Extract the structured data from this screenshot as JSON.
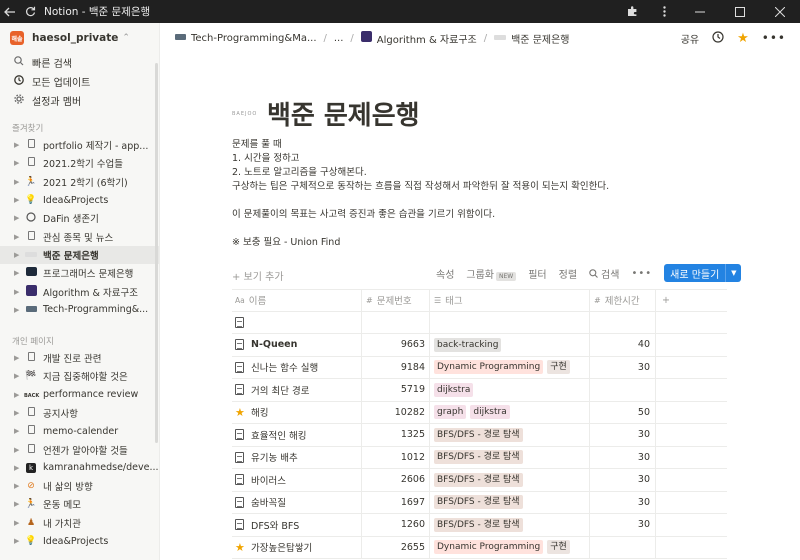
{
  "window": {
    "title": "Notion - 백준 문제은행"
  },
  "workspace": {
    "name": "haesol_private",
    "logo_text": "해솔"
  },
  "sidebar": {
    "top_items": [
      {
        "icon": "search-icon",
        "label": "빠른 검색"
      },
      {
        "icon": "clock-icon",
        "label": "모든 업데이트"
      },
      {
        "icon": "gear-icon",
        "label": "설정과 멤버"
      }
    ],
    "favorites_label": "즐겨찾기",
    "favorites": [
      {
        "icon": "doc-icon",
        "label": "portfolio 제작기 - app..."
      },
      {
        "icon": "doc-icon",
        "label": "2021.2학기 수업들"
      },
      {
        "icon": "runner-icon",
        "label": "2021 2학기 (6학기)"
      },
      {
        "icon": "bulb-icon",
        "label": "Idea&Projects"
      },
      {
        "icon": "circle-icon",
        "label": "DaFin 생존기"
      },
      {
        "icon": "doc-icon",
        "label": "관심 종목 및 뉴스"
      },
      {
        "icon": "baekjoon-icon",
        "label": "백준 문제은행",
        "active": true
      },
      {
        "icon": "programmers-icon",
        "label": "프로그래머스 문제은행"
      },
      {
        "icon": "algorithm-icon",
        "label": "Algorithm & 자료구조"
      },
      {
        "icon": "laptop-icon",
        "label": "Tech-Programming&..."
      }
    ],
    "private_label": "개인 페이지",
    "private": [
      {
        "icon": "doc-icon",
        "label": "개발 진로 관련"
      },
      {
        "icon": "flag-icon",
        "label": "지금 집중해야할 것은"
      },
      {
        "icon": "back-icon",
        "label": "performance review"
      },
      {
        "icon": "doc-icon",
        "label": "공지사항"
      },
      {
        "icon": "doc-icon",
        "label": "memo-calender"
      },
      {
        "icon": "doc-icon",
        "label": "언젠가 알아야할 것들"
      },
      {
        "icon": "k-icon",
        "label": "kamranahmedse/deve..."
      },
      {
        "icon": "no-icon",
        "label": "내 삶의 방향"
      },
      {
        "icon": "runner-icon",
        "label": "운동 메모"
      },
      {
        "icon": "pawn-icon",
        "label": "내 가치관"
      },
      {
        "icon": "bulb-icon",
        "label": "Idea&Projects"
      }
    ]
  },
  "topbar": {
    "breadcrumbs": [
      {
        "icon": "laptop-icon",
        "label": "Tech-Programming&Ma..."
      },
      {
        "icon": "",
        "label": "..."
      },
      {
        "icon": "algorithm-icon",
        "label": "Algorithm & 자료구조"
      },
      {
        "icon": "baekjoon-icon",
        "label": "백준 문제은행"
      }
    ],
    "share_label": "공유"
  },
  "page": {
    "icon_text": "BAEJOO",
    "title": "백준 문제은행",
    "description": [
      "문제를 풀 때",
      "1. 시간을 정하고",
      "2. 노트로 알고리즘을 구상해본다.",
      "구상하는 팁은 구체적으로 동작하는 흐름을 직접 작성해서 파악한뒤 잘 적용이 되는지 확인한다.",
      "",
      "이 문제풀이의 목표는 사고력 증진과 좋은 습관을 기르기 위함이다.",
      "",
      "※ 보충 필요 - Union Find"
    ]
  },
  "database": {
    "add_view_label": "+ 보기 추가",
    "tools": [
      "속성",
      "그룹화",
      "필터",
      "정렬",
      "검색"
    ],
    "new_badge": "NEW",
    "new_button_label": "새로 만들기",
    "columns": [
      "이름",
      "문제번호",
      "태그",
      "제한시간"
    ],
    "rows": [
      {
        "icon": "doc",
        "name": "",
        "number": "",
        "tags": [],
        "time": ""
      },
      {
        "icon": "doc",
        "name": "N-Queen",
        "bold": true,
        "number": "9663",
        "tags": [
          {
            "t": "back-tracking",
            "c": "gray"
          }
        ],
        "time": "40"
      },
      {
        "icon": "doc",
        "name": "신나는 함수 실행",
        "number": "9184",
        "tags": [
          {
            "t": "Dynamic Programming",
            "c": "red"
          },
          {
            "t": "구현",
            "c": "tan"
          }
        ],
        "time": "30"
      },
      {
        "icon": "doc",
        "name": "거의 최단 경로",
        "number": "5719",
        "tags": [
          {
            "t": "dijkstra",
            "c": "pink"
          }
        ],
        "time": ""
      },
      {
        "icon": "star",
        "name": "해킹",
        "number": "10282",
        "tags": [
          {
            "t": "graph",
            "c": "pink"
          },
          {
            "t": "dijkstra",
            "c": "pink"
          }
        ],
        "time": "50"
      },
      {
        "icon": "doc",
        "name": "효율적인 해킹",
        "number": "1325",
        "tags": [
          {
            "t": "BFS/DFS - 경로 탐색",
            "c": "brown"
          }
        ],
        "time": "30"
      },
      {
        "icon": "doc",
        "name": "유기농 배추",
        "number": "1012",
        "tags": [
          {
            "t": "BFS/DFS - 경로 탐색",
            "c": "brown"
          }
        ],
        "time": "30"
      },
      {
        "icon": "doc",
        "name": "바이러스",
        "number": "2606",
        "tags": [
          {
            "t": "BFS/DFS - 경로 탐색",
            "c": "brown"
          }
        ],
        "time": "30"
      },
      {
        "icon": "doc",
        "name": "숨바꼭질",
        "number": "1697",
        "tags": [
          {
            "t": "BFS/DFS - 경로 탐색",
            "c": "brown"
          }
        ],
        "time": "30"
      },
      {
        "icon": "doc",
        "name": "DFS와 BFS",
        "number": "1260",
        "tags": [
          {
            "t": "BFS/DFS - 경로 탐색",
            "c": "brown"
          }
        ],
        "time": "30"
      },
      {
        "icon": "star",
        "name": "가장높은탑쌓기",
        "number": "2655",
        "tags": [
          {
            "t": "Dynamic Programming",
            "c": "red"
          },
          {
            "t": "구현",
            "c": "tan"
          }
        ],
        "time": ""
      }
    ]
  },
  "colors": {
    "accent": "#2383e2",
    "sidebar_bg": "#f7f7f5",
    "titlebar_bg": "#202020"
  }
}
